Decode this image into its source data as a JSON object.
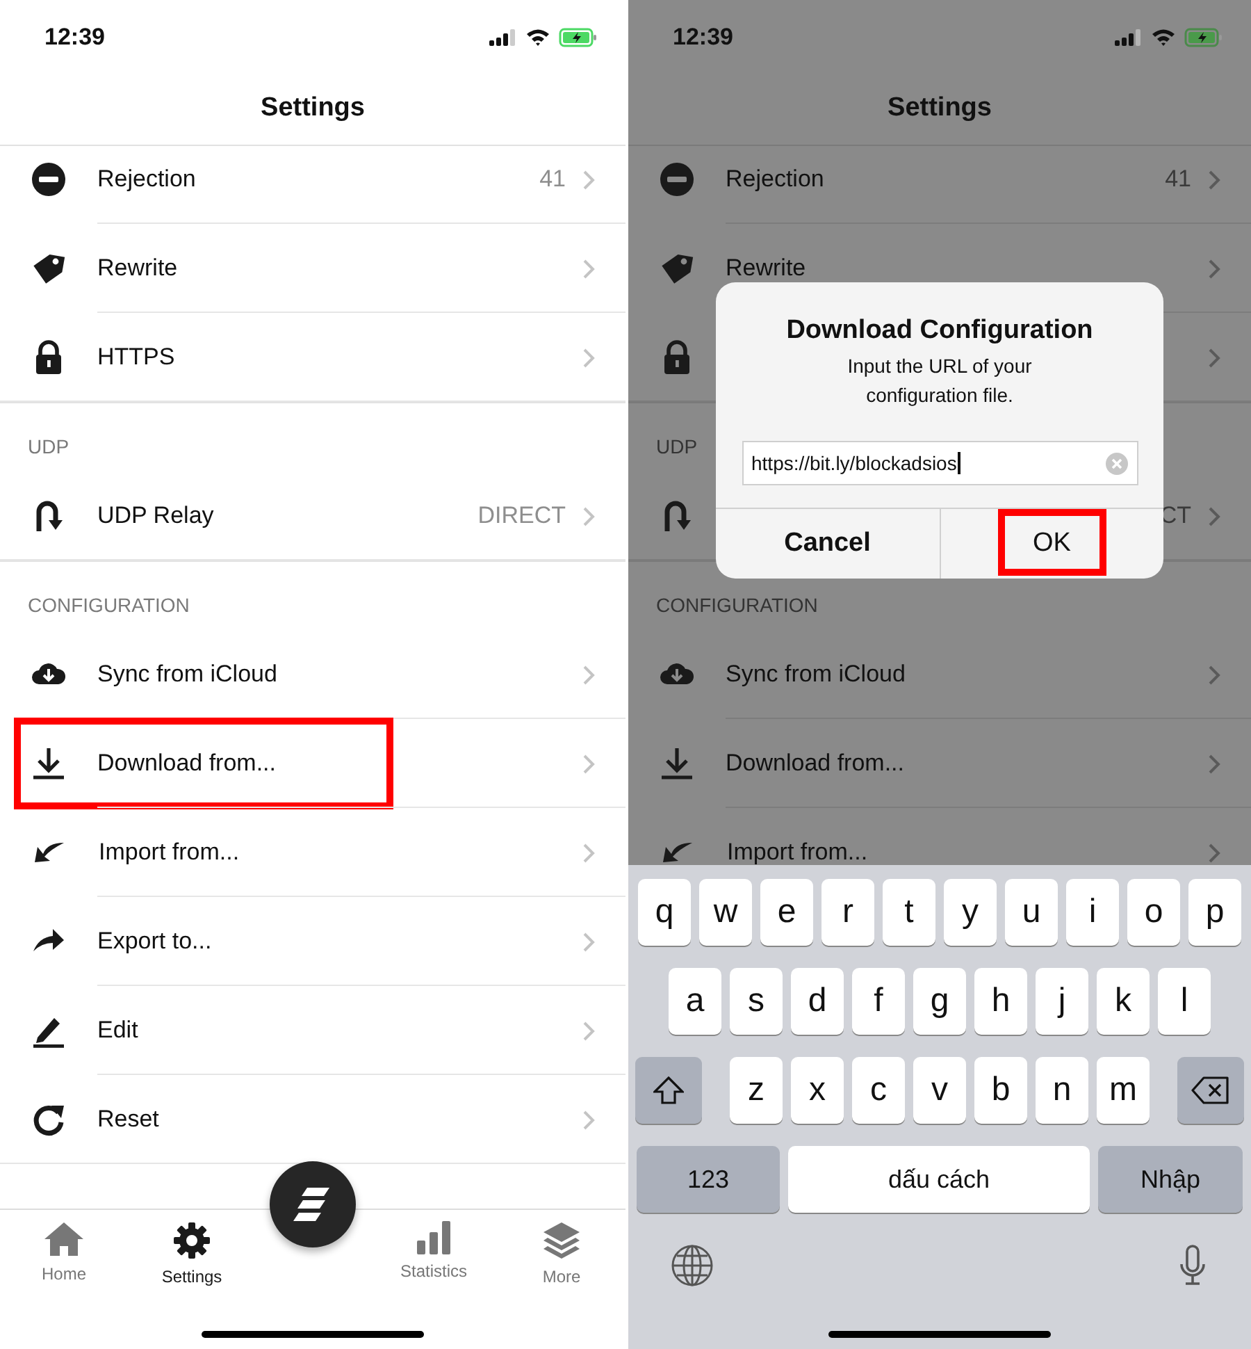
{
  "left_screen": {
    "status_bar": {
      "time": "12:39"
    },
    "title": "Settings",
    "sections": [
      {
        "items": [
          {
            "label": "Rejection",
            "value": "41",
            "highlighted": false
          },
          {
            "label": "Rewrite",
            "highlighted": false
          },
          {
            "label": "HTTPS",
            "highlighted": false
          }
        ]
      },
      {
        "header": "UDP",
        "items": [
          {
            "label": "UDP Relay",
            "value": "DIRECT",
            "highlighted": false
          }
        ]
      },
      {
        "header": "CONFIGURATION",
        "items": [
          {
            "label": "Sync from iCloud",
            "highlighted": false
          },
          {
            "label": "Download from...",
            "highlighted": true
          },
          {
            "label": "Import from...",
            "highlighted": false
          },
          {
            "label": "Export to...",
            "highlighted": false
          },
          {
            "label": "Edit",
            "highlighted": false
          },
          {
            "label": "Reset",
            "highlighted": false
          }
        ]
      }
    ],
    "tabs": [
      {
        "label": "Home",
        "selected": false
      },
      {
        "label": "Settings",
        "selected": true
      },
      {
        "label": "Statistics",
        "selected": false
      },
      {
        "label": "More",
        "selected": false
      }
    ]
  },
  "right_screen": {
    "status_bar": {
      "time": "12:39"
    },
    "title": "Settings",
    "sections": [
      {
        "items": [
          {
            "kind": "row",
            "label": "Rejection",
            "value": "41"
          },
          {
            "kind": "row",
            "label": "Rewrite"
          },
          {
            "kind": "covered"
          }
        ]
      },
      {
        "header": "UDP",
        "items": [
          {
            "kind": "covered",
            "value": "CT"
          }
        ]
      },
      {
        "header": "CONFIGURATION",
        "items": [
          {
            "kind": "row",
            "label": "Sync from iCloud"
          },
          {
            "kind": "row",
            "label": "Download from..."
          },
          {
            "kind": "row",
            "label": "Import from..."
          }
        ]
      }
    ],
    "dialog": {
      "title": "Download Configuration",
      "message": "Input the URL of your configuration file.",
      "field": {
        "value": "https://bit.ly/blockadsios"
      },
      "buttons": [
        {
          "label": "Cancel",
          "highlighted": false
        },
        {
          "label": "OK",
          "highlighted": true
        }
      ]
    },
    "keyboard": {
      "letter_rows": [
        [
          "q",
          "w",
          "e",
          "r",
          "t",
          "y",
          "u",
          "i",
          "o",
          "p"
        ],
        [
          "a",
          "s",
          "d",
          "f",
          "g",
          "h",
          "j",
          "k",
          "l"
        ],
        [
          "z",
          "x",
          "c",
          "v",
          "b",
          "n",
          "m"
        ]
      ],
      "numbers_key": "123",
      "space_key": "dấu cách",
      "return_key": "Nhập"
    }
  }
}
